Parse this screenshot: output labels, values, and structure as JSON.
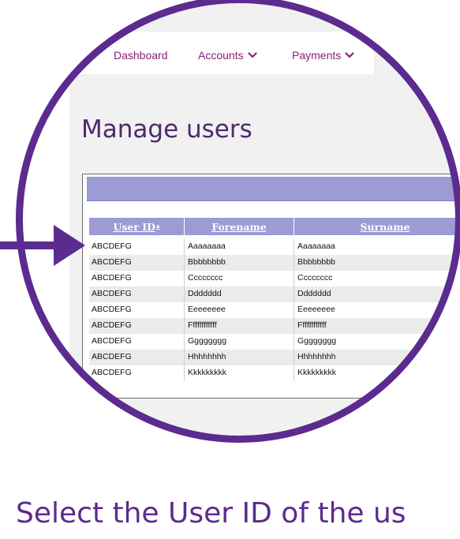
{
  "nav": {
    "items": [
      {
        "label": "Dashboard",
        "has_dropdown": false
      },
      {
        "label": "Accounts",
        "has_dropdown": true
      },
      {
        "label": "Payments",
        "has_dropdown": true
      }
    ]
  },
  "page_title": "Manage users",
  "table": {
    "columns": [
      {
        "label": "User ID",
        "sort_indicator": "▴"
      },
      {
        "label": "Forename",
        "sort_indicator": ""
      },
      {
        "label": "Surname",
        "sort_indicator": ""
      }
    ],
    "rows": [
      {
        "user_id": "ABCDEFG",
        "forename": "Aaaaaaaa",
        "surname": "Aaaaaaaa"
      },
      {
        "user_id": "ABCDEFG",
        "forename": "Bbbbbbbb",
        "surname": "Bbbbbbbb"
      },
      {
        "user_id": "ABCDEFG",
        "forename": "Cccccccc",
        "surname": "Cccccccc"
      },
      {
        "user_id": "ABCDEFG",
        "forename": "Ddddddd",
        "surname": "Ddddddd"
      },
      {
        "user_id": "ABCDEFG",
        "forename": "Eeeeeeee",
        "surname": "Eeeeeeee"
      },
      {
        "user_id": "ABCDEFG",
        "forename": "Ffffffffffff",
        "surname": "Ffffffffffff"
      },
      {
        "user_id": "ABCDEFG",
        "forename": "Gggggggg",
        "surname": "Gggggggg"
      },
      {
        "user_id": "ABCDEFG",
        "forename": "Hhhhhhhh",
        "surname": "Hhhhhhhh"
      },
      {
        "user_id": "ABCDEFG",
        "forename": "Kkkkkkkkk",
        "surname": "Kkkkkkkkk"
      }
    ]
  },
  "caption": "Select the User ID of the us",
  "colors": {
    "brand_purple": "#5b2b8f",
    "nav_text": "#8a1f78",
    "title_text": "#4c2a6e",
    "table_header": "#9c9bd3",
    "row_alt": "#ebebeb"
  },
  "icons": {
    "dropdown": "chevron-down-icon",
    "pointer": "arrow-right-icon"
  }
}
